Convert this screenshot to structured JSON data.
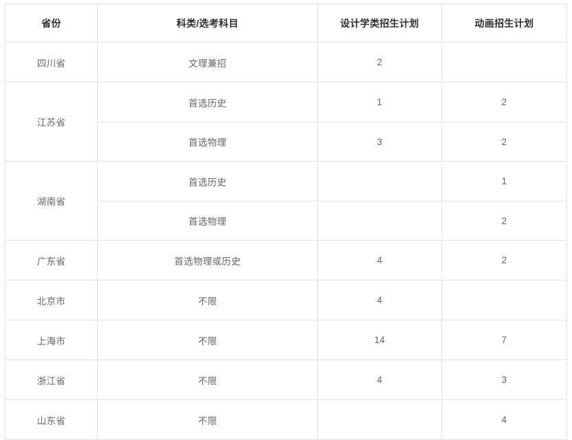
{
  "table": {
    "headers": [
      "省份",
      "科类/选考科目",
      "设计学类招生计划",
      "动画招生计划"
    ],
    "rows": [
      {
        "province": "四川省",
        "province_rowspan": 1,
        "subject": "文理兼招",
        "design_plan": "2",
        "animation_plan": ""
      },
      {
        "province": "江苏省",
        "province_rowspan": 2,
        "subject": "首选历史",
        "design_plan": "1",
        "animation_plan": "2"
      },
      {
        "province": "",
        "province_rowspan": 0,
        "subject": "首选物理",
        "design_plan": "3",
        "animation_plan": "2"
      },
      {
        "province": "湖南省",
        "province_rowspan": 2,
        "subject": "首选历史",
        "design_plan": "",
        "animation_plan": "1"
      },
      {
        "province": "",
        "province_rowspan": 0,
        "subject": "首选物理",
        "design_plan": "",
        "animation_plan": "2"
      },
      {
        "province": "广东省",
        "province_rowspan": 1,
        "subject": "首选物理或历史",
        "design_plan": "4",
        "animation_plan": "2"
      },
      {
        "province": "北京市",
        "province_rowspan": 1,
        "subject": "不限",
        "design_plan": "4",
        "animation_plan": ""
      },
      {
        "province": "上海市",
        "province_rowspan": 1,
        "subject": "不限",
        "design_plan": "14",
        "animation_plan": "7"
      },
      {
        "province": "浙江省",
        "province_rowspan": 1,
        "subject": "不限",
        "design_plan": "4",
        "animation_plan": "3"
      },
      {
        "province": "山东省",
        "province_rowspan": 1,
        "subject": "不限",
        "design_plan": "",
        "animation_plan": "4"
      }
    ]
  },
  "colors": {
    "border": "#e3e3e3",
    "header_text": "#2f2f2f",
    "body_text": "#666666",
    "background": "#ffffff"
  }
}
